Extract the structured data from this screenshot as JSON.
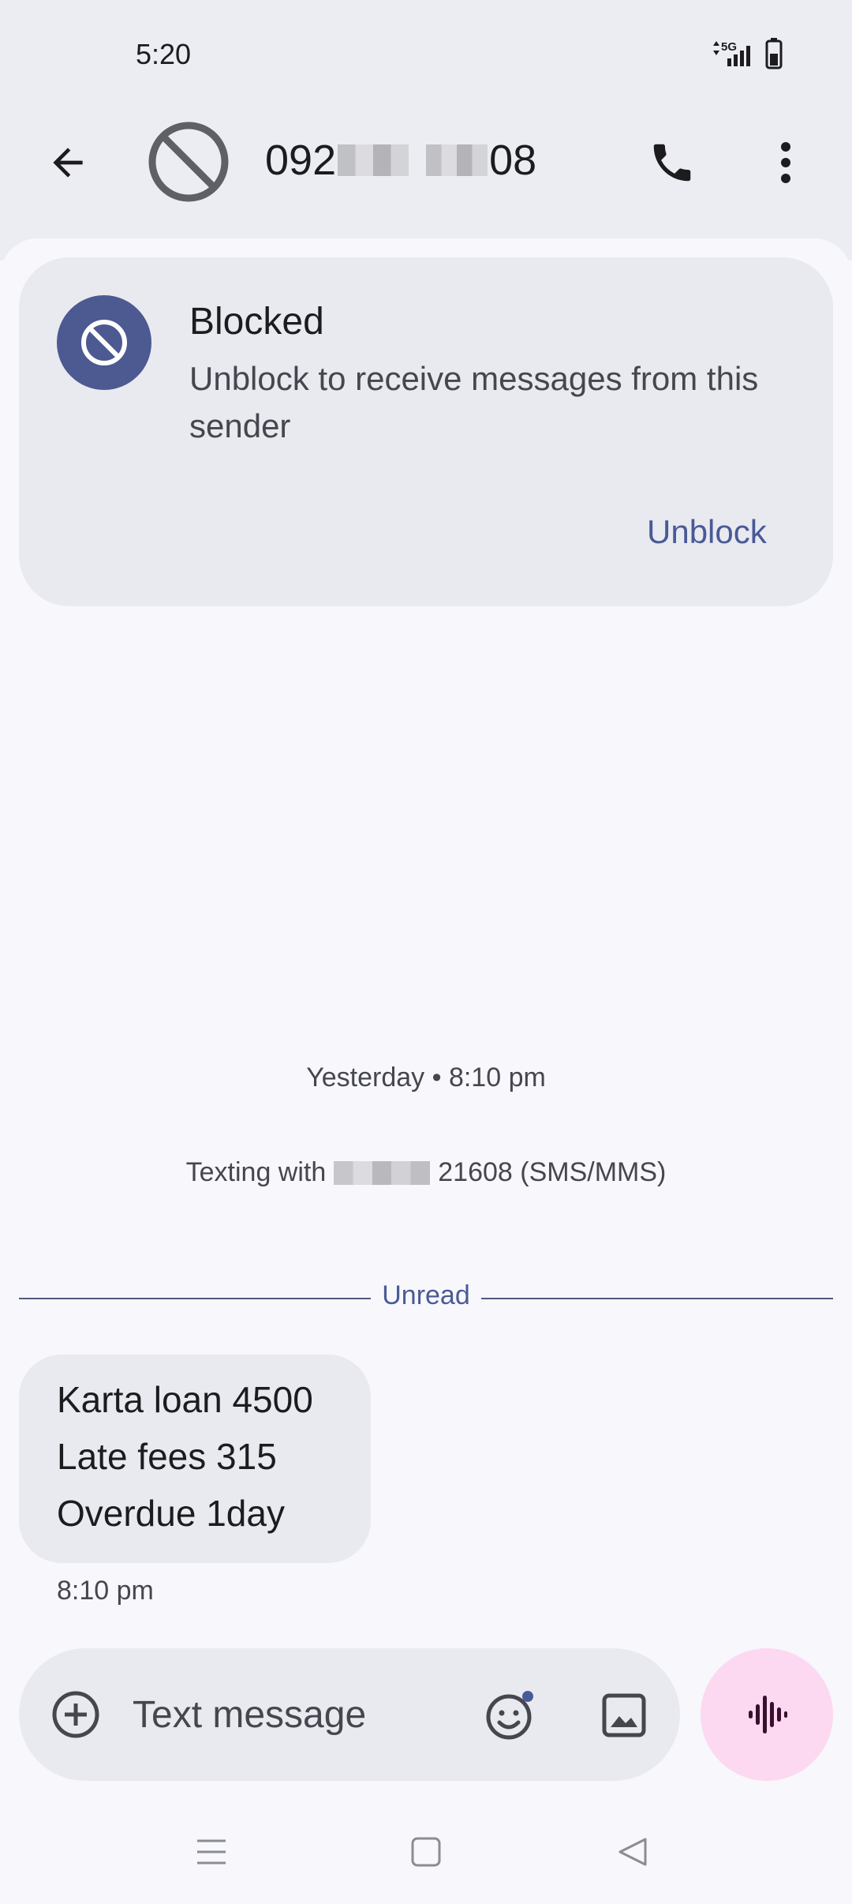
{
  "status_bar": {
    "time": "5:20",
    "network": "5G"
  },
  "app_bar": {
    "contact_prefix": "092",
    "contact_suffix": "08",
    "back_icon": "arrow-back-icon",
    "avatar_icon": "block-icon",
    "call_icon": "phone-icon",
    "more_icon": "more-vert-icon"
  },
  "blocked_card": {
    "title": "Blocked",
    "description": "Unblock to receive messages from this sender",
    "action": "Unblock"
  },
  "conversation": {
    "date_stamp": "Yesterday • 8:10 pm",
    "texting_with_prefix": "Texting with",
    "texting_with_suffix": "21608 (SMS/MMS)",
    "unread_label": "Unread",
    "messages": [
      {
        "lines": [
          "Karta loan 4500",
          "Late fees 315",
          "Overdue 1day"
        ],
        "time": "8:10 pm"
      }
    ]
  },
  "composer": {
    "placeholder": "Text message",
    "add_icon": "add-circle-icon",
    "emoji_icon": "emoji-icon",
    "gallery_icon": "image-icon",
    "voice_icon": "voice-wave-icon"
  },
  "colors": {
    "accent": "#4c5a91",
    "link": "#4a5a96",
    "voice_button": "#fcd9f0",
    "card_bg": "#e9eaf0"
  }
}
